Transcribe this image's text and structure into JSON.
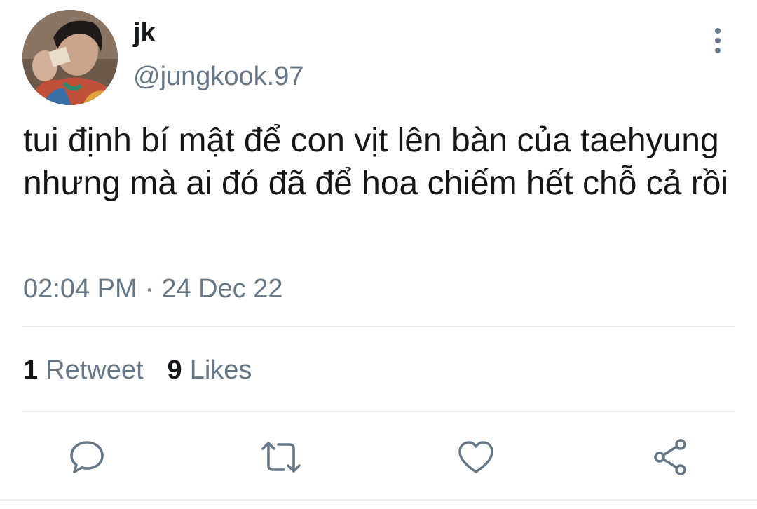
{
  "header": {
    "display_name": "jk",
    "handle": "@jungkook.97"
  },
  "tweet": {
    "text": "tui định bí mật để con vịt lên bàn của taehyung nhưng mà ai đó đã để hoa chiếm hết chỗ cả rồi",
    "time": "02:04 PM",
    "separator": "·",
    "date": "24 Dec 22"
  },
  "stats": {
    "retweets_count": "1",
    "retweets_label": "Retweet",
    "likes_count": "9",
    "likes_label": "Likes"
  },
  "actions": [
    "reply-icon",
    "retweet-icon",
    "like-icon",
    "share-icon"
  ],
  "colors": {
    "text": "#14171a",
    "secondary": "#657786",
    "divider": "#e6ecf0"
  }
}
